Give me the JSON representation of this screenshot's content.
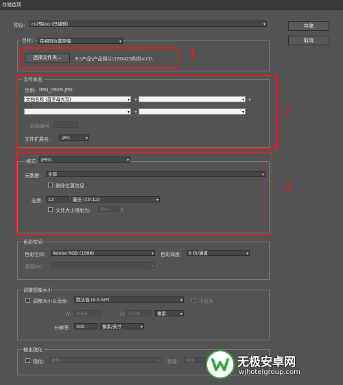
{
  "window": {
    "title": "存储选项"
  },
  "preset": {
    "label": "预设:",
    "value": "cr2转jpg (已编辑)"
  },
  "buttons": {
    "save": "存储",
    "cancel": "取消"
  },
  "destination": {
    "group_title": "目标:",
    "value": "在相同位置存储",
    "select_folder": "选择文件夹...",
    "path": "E:\\产品\\产品照片\\190425附件\\cr2\\"
  },
  "file_naming": {
    "title": "文件命名",
    "example_label": "示例:",
    "example_value": "IMG_0929.JPG",
    "field1": "文档名称 (首字母大写)",
    "plus": "+",
    "start_number_label": "起始编号",
    "extension_label": "文件扩展名:",
    "extension_value": ".JPG"
  },
  "format": {
    "label": "格式:",
    "value": "JPEG",
    "metadata_label": "元数据:",
    "metadata_value": "全部",
    "remove_location": "删除位置信息",
    "quality_label": "品质:",
    "quality_number": "12",
    "quality_value": "最佳 (10-12)",
    "limit_size": "文件大小限制为:",
    "limit_value": "500",
    "limit_unit": "K"
  },
  "color_space": {
    "title": "色彩空间",
    "space_label": "色彩空间:",
    "space_value": "Adobe RGB (1998)",
    "depth_label": "色彩深度:",
    "depth_value": "8 位/通道",
    "intent_label": "意图(H):"
  },
  "resize": {
    "title": "调整图像大小",
    "fit_label": "调整大小以适合:",
    "fit_value": "默认值 (6.5 MP)",
    "no_enlarge": "不放大",
    "w_label": "W:",
    "w_value": "2560",
    "h_label": "H:",
    "h_value": "1728",
    "unit": "像素",
    "resolution_label": "分辨率:",
    "resolution_value": "300",
    "resolution_unit": "像素/英寸"
  },
  "sharpen": {
    "title": "输出锐化",
    "label": "锐化:",
    "value": "滤色",
    "amount_label": "数量:",
    "amount_value": "标准"
  },
  "annotations": {
    "n1": "1",
    "n2": "2",
    "n3": "3",
    "color": "#e02020"
  },
  "watermark": {
    "brand": "无极安卓网",
    "url": "wjhotelgroup.com"
  }
}
